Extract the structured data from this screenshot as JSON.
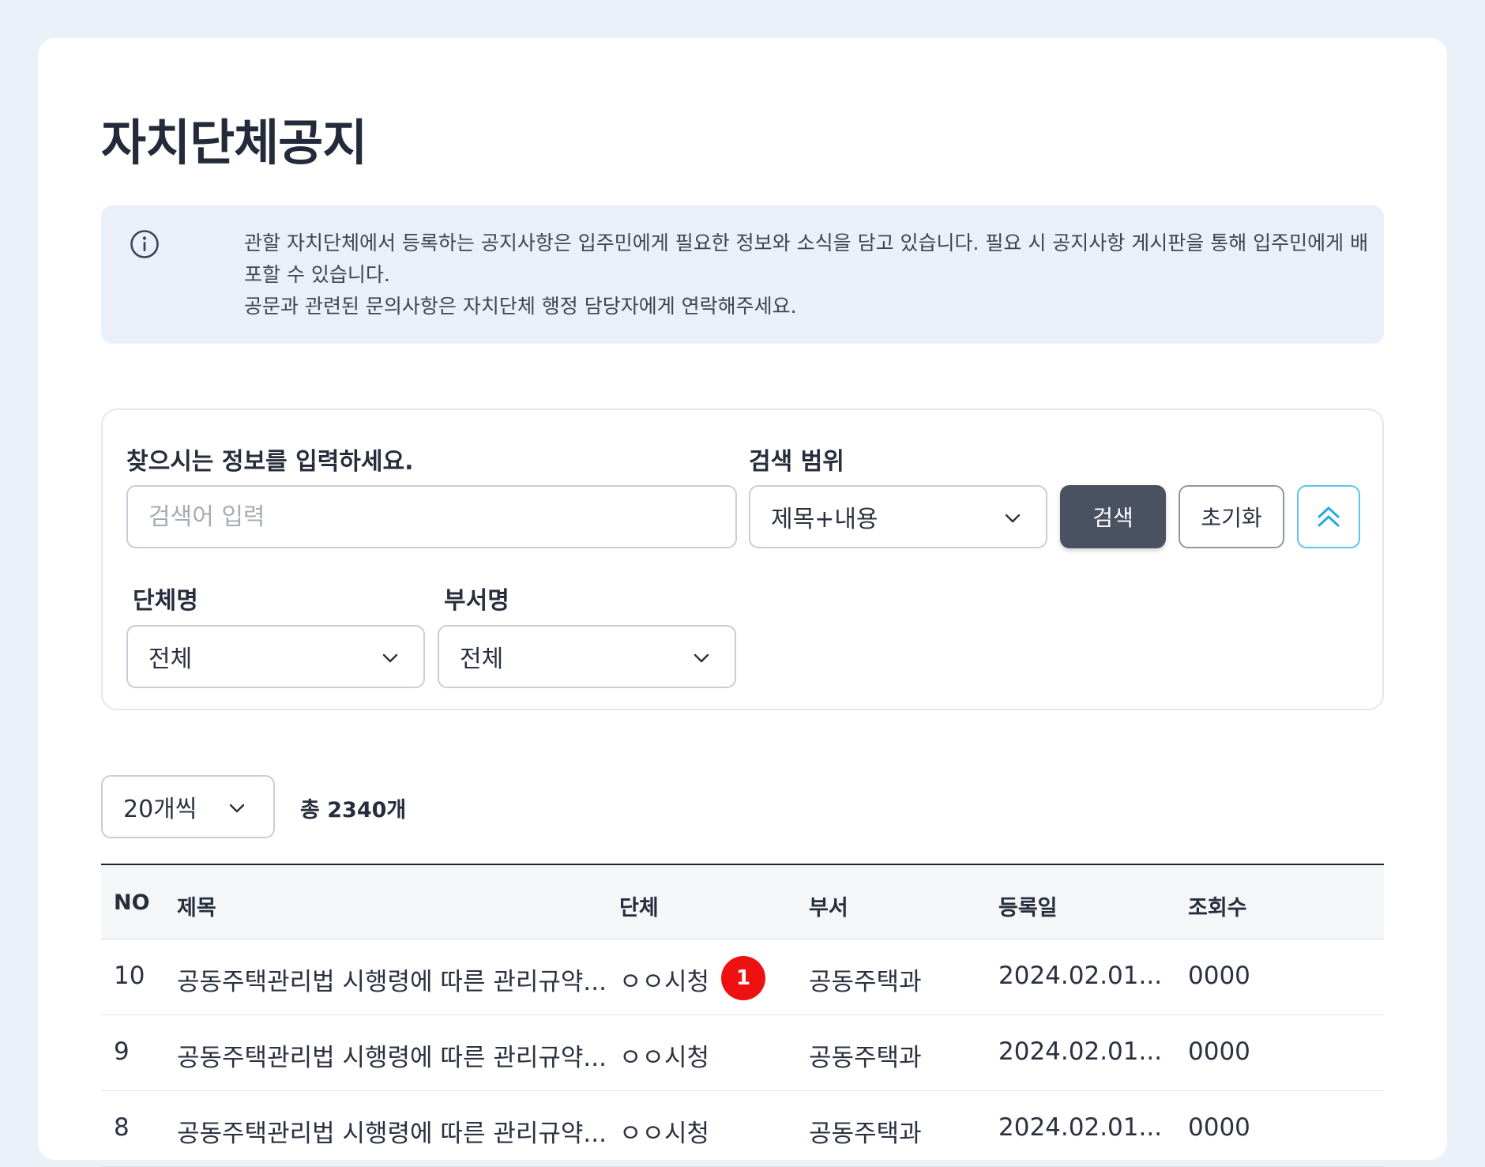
{
  "page": {
    "title": "자치단체공지"
  },
  "notice": {
    "icon": "info-circle-icon",
    "lines": [
      "관할 자치단체에서 등록하는 공지사항은 입주민에게 필요한 정보와 소식을 담고 있습니다. 필요 시 공지사항 게시판을 통해 입주민에게 배",
      "포할 수 있습니다.",
      "공문과 관련된 문의사항은 자치단체 행정 담당자에게 연락해주세요."
    ]
  },
  "search": {
    "keyword_label": "찾으시는 정보를 입력하세요.",
    "keyword_placeholder": "검색어 입력",
    "keyword_value": "",
    "scope_label": "검색 범위",
    "scope_value": "제목+내용",
    "search_button": "검색",
    "reset_button": "초기화",
    "org_label": "단체명",
    "org_value": "전체",
    "dept_label": "부서명",
    "dept_value": "전체"
  },
  "list": {
    "page_size": "20개씩",
    "total": "총 2340개"
  },
  "table": {
    "headers": {
      "no": "NO",
      "title": "제목",
      "org": "단체",
      "dept": "부서",
      "date": "등록일",
      "views": "조회수"
    },
    "rows": [
      {
        "no": "10",
        "title": "공동주택관리법 시행령에 따른 관리규약...",
        "org": "ㅇㅇ시청",
        "badge": "1",
        "dept": "공동주택과",
        "date": "2024.02.01...",
        "views": "0000"
      },
      {
        "no": "9",
        "title": "공동주택관리법 시행령에 따른 관리규약...",
        "org": "ㅇㅇ시청",
        "dept": "공동주택과",
        "date": "2024.02.01...",
        "views": "0000"
      },
      {
        "no": "8",
        "title": "공동주택관리법 시행령에 따른 관리규약...",
        "org": "ㅇㅇ시청",
        "dept": "공동주택과",
        "date": "2024.02.01...",
        "views": "0000"
      }
    ]
  },
  "colors": {
    "background": "#ebf1f9",
    "notice_bg": "#e9f0f9",
    "search_button_bg": "#4a5160",
    "collapse_accent": "#5fc3ee",
    "badge": "#ee1111"
  }
}
